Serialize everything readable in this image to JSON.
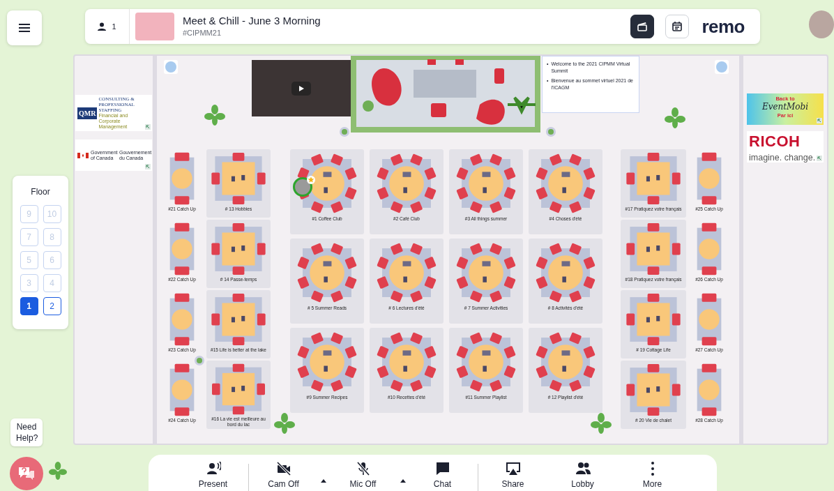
{
  "top_bar": {
    "attendee_count": "1",
    "title": "Meet & Chill - June 3 Morning",
    "hashtag": "#CIPMM21",
    "brand": "remo",
    "tools": [
      {
        "kind": "clapperboard",
        "active": true
      },
      {
        "kind": "calendar",
        "active": false
      }
    ]
  },
  "floor_selector": {
    "title": "Floor",
    "floors": [
      {
        "label": "9",
        "selected": false,
        "disabled": true
      },
      {
        "label": "10",
        "selected": false,
        "disabled": true
      },
      {
        "label": "7",
        "selected": false,
        "disabled": true
      },
      {
        "label": "8",
        "selected": false,
        "disabled": true
      },
      {
        "label": "5",
        "selected": false,
        "disabled": true
      },
      {
        "label": "6",
        "selected": false,
        "disabled": true
      },
      {
        "label": "3",
        "selected": false,
        "disabled": true
      },
      {
        "label": "4",
        "selected": false,
        "disabled": true
      },
      {
        "label": "1",
        "selected": true,
        "disabled": false
      },
      {
        "label": "2",
        "selected": false,
        "disabled": false
      }
    ]
  },
  "sponsors_left": [
    {
      "kind": "qmr",
      "texts": [
        "QMR",
        "CONSULTING &",
        "PROFESSIONAL STAFFING",
        "Financial and Corporate Management"
      ]
    },
    {
      "kind": "canada",
      "texts": [
        "Government of Canada",
        "Gouvernement du Canada"
      ]
    }
  ],
  "sponsors_right": [
    {
      "kind": "eventmobi",
      "texts": [
        "Back to",
        "EventMobi",
        "Par ici"
      ]
    },
    {
      "kind": "ricoh",
      "texts": [
        "RICOH",
        "imagine. change."
      ]
    }
  ],
  "welcome_note": {
    "items": [
      {
        "marker": "•",
        "text": "Welcome to the 2021 CIPMM Virtual Summit"
      },
      {
        "marker": "•",
        "text": "Bienvenue au sommet virtuel 2021 de l'ICAGM"
      }
    ]
  },
  "tables_left_small": [
    {
      "label": "#21 Catch Up",
      "kind": "small"
    },
    {
      "label": "#22 Catch Up",
      "kind": "small"
    },
    {
      "label": "#23 Catch Up",
      "kind": "small"
    },
    {
      "label": "#24 Catch Up",
      "kind": "small"
    }
  ],
  "tables_left": [
    {
      "label": "# 13 Hobbies",
      "kind": "square"
    },
    {
      "label": "# 14 Passe-temps",
      "kind": "square"
    },
    {
      "label": "#15 Life is better at the lake",
      "kind": "square"
    },
    {
      "label": "#16 La vie est meilleure au bord du lac",
      "kind": "square"
    }
  ],
  "tables_center": [
    {
      "label": "#1 Coffee Club",
      "kind": "round",
      "occupied": true
    },
    {
      "label": "#2 Café Club",
      "kind": "round",
      "occupied": false
    },
    {
      "label": "#3 All things summer",
      "kind": "round",
      "occupied": false
    },
    {
      "label": "#4 Choses d'été",
      "kind": "round",
      "occupied": false
    },
    {
      "label": "# 5 Summer Reads",
      "kind": "round",
      "occupied": false
    },
    {
      "label": "# 6 Lectures d'été",
      "kind": "round",
      "occupied": false
    },
    {
      "label": "# 7 Summer Activities",
      "kind": "round",
      "occupied": false
    },
    {
      "label": "# 8 Activités d'été",
      "kind": "round",
      "occupied": false
    },
    {
      "label": "#9 Summer Recipes",
      "kind": "round",
      "occupied": false
    },
    {
      "label": "#10 Recettes d'été",
      "kind": "round",
      "occupied": false
    },
    {
      "label": "#11 Summer Playlist",
      "kind": "round",
      "occupied": false
    },
    {
      "label": "# 12 Playlist d'été",
      "kind": "round",
      "occupied": false
    }
  ],
  "tables_right": [
    {
      "label": "#17 Pratiquez votre français",
      "kind": "square"
    },
    {
      "label": "#18 Pratiquez votre français",
      "kind": "square"
    },
    {
      "label": "# 19 Cottage Life",
      "kind": "square"
    },
    {
      "label": "# 20 Vie de chalet",
      "kind": "square"
    }
  ],
  "tables_right_small": [
    {
      "label": "#25 Catch Up",
      "kind": "small"
    },
    {
      "label": "#26 Catch Up",
      "kind": "small"
    },
    {
      "label": "#27 Catch Up",
      "kind": "small"
    },
    {
      "label": "#28 Catch Up",
      "kind": "small"
    }
  ],
  "help": {
    "label": "Need Help?"
  },
  "bottom_bar": [
    {
      "label": "Present",
      "kind": "present",
      "has_menu": false,
      "divider_after": true
    },
    {
      "label": "Cam Off",
      "kind": "cam_off",
      "has_menu": true,
      "divider_after": false
    },
    {
      "label": "Mic Off",
      "kind": "mic_off",
      "has_menu": true,
      "divider_after": false
    },
    {
      "label": "Chat",
      "kind": "chat",
      "has_menu": false,
      "divider_after": true
    },
    {
      "label": "Share",
      "kind": "share",
      "has_menu": false,
      "divider_after": false
    },
    {
      "label": "Lobby",
      "kind": "lobby",
      "has_menu": false,
      "divider_after": false
    },
    {
      "label": "More",
      "kind": "more",
      "has_menu": false,
      "divider_after": false
    }
  ]
}
